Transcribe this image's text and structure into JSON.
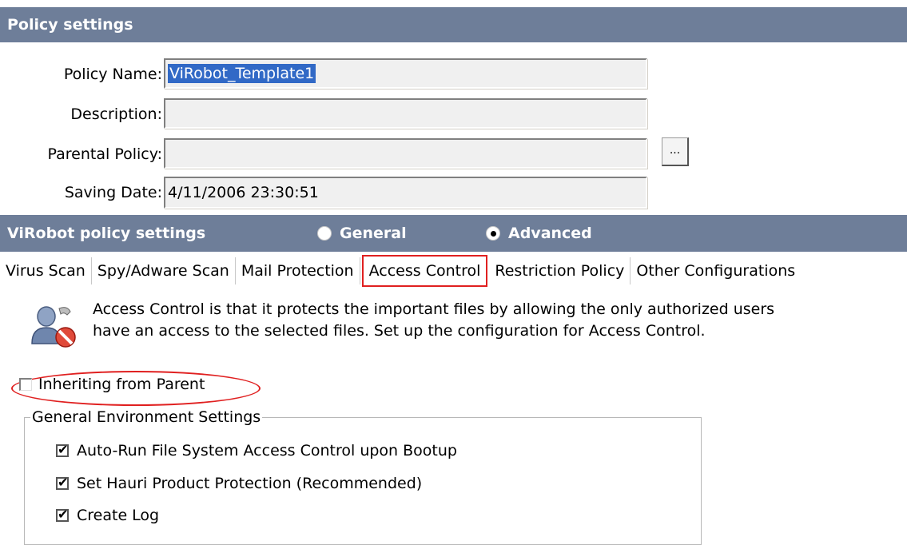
{
  "policy_settings": {
    "title": "Policy settings",
    "policy_name_label": "Policy Name:",
    "policy_name_value": "ViRobot_Template1",
    "description_label": "Description:",
    "description_value": "",
    "parental_label": "Parental Policy:",
    "parental_value": "",
    "browse_label": "...",
    "saving_date_label": "Saving Date:",
    "saving_date_value": "4/11/2006 23:30:51"
  },
  "virobot": {
    "title": "ViRobot policy settings",
    "mode_general": "General",
    "mode_advanced": "Advanced",
    "selected_mode": "Advanced"
  },
  "tabs": [
    {
      "label": "Virus Scan"
    },
    {
      "label": "Spy/Adware Scan"
    },
    {
      "label": "Mail Protection"
    },
    {
      "label": "Access Control",
      "active": true
    },
    {
      "label": "Restriction Policy"
    },
    {
      "label": "Other Configurations"
    }
  ],
  "access_control": {
    "icon": "user-prohibited-icon",
    "description": "Access Control is that it protects the important files by allowing the only authorized users have an access to the selected files. Set up the configuration for Access Control.",
    "inherit_label": "Inheriting from Parent",
    "inherit_checked": false,
    "group_title": "General Environment Settings",
    "options": [
      {
        "label": "Auto-Run File System Access Control upon Bootup",
        "checked": true
      },
      {
        "label": "Set Hauri Product Protection (Recommended)",
        "checked": true
      },
      {
        "label": "Create Log",
        "checked": true
      }
    ]
  },
  "colors": {
    "header_bg": "#6e7e99",
    "selection": "#3169c6",
    "highlight_red": "#e02020"
  }
}
